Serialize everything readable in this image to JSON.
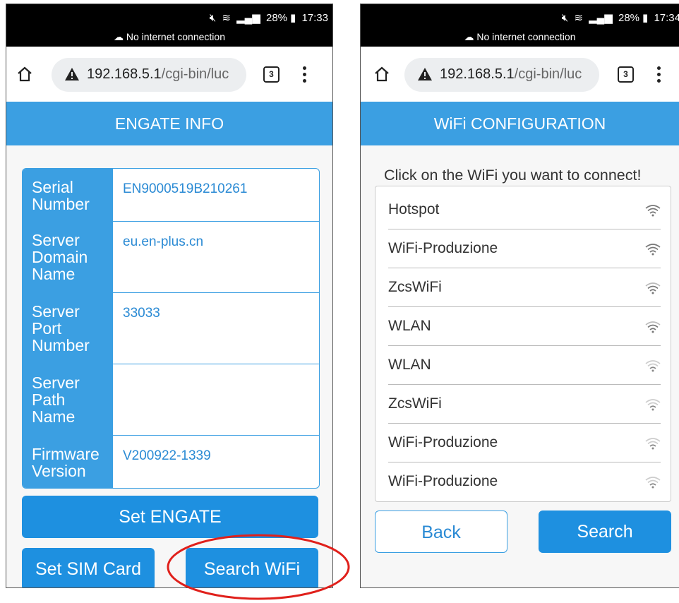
{
  "status_bar": {
    "left_screen": {
      "battery": "28%",
      "time": "17:33"
    },
    "right_screen": {
      "battery": "28%",
      "time": "17:34"
    },
    "no_internet": "No internet connection"
  },
  "browser": {
    "url_host": "192.168.5.1",
    "url_path": "/cgi-bin/luc",
    "tab_count": "3"
  },
  "engate_info": {
    "title": "ENGATE INFO",
    "rows": [
      {
        "label": "Serial Number",
        "value": "EN9000519B210261"
      },
      {
        "label": "Server Domain Name",
        "value": "eu.en-plus.cn"
      },
      {
        "label": "Server Port Number",
        "value": "33033"
      },
      {
        "label": "Server Path Name",
        "value": ""
      },
      {
        "label": "Firmware Version",
        "value": "V200922-1339"
      }
    ],
    "buttons": {
      "set_engate": "Set ENGATE",
      "set_sim_card": "Set SIM Card",
      "search_wifi": "Search WiFi"
    }
  },
  "wifi_config": {
    "title": "WiFi CONFIGURATION",
    "prompt": "Click on the WiFi you want to connect!",
    "networks": [
      {
        "name": "Hotspot",
        "signal": "strong"
      },
      {
        "name": "WiFi-Produzione",
        "signal": "strong"
      },
      {
        "name": "ZcsWiFi",
        "signal": "medium"
      },
      {
        "name": "WLAN",
        "signal": "medium"
      },
      {
        "name": "WLAN",
        "signal": "weak"
      },
      {
        "name": "ZcsWiFi",
        "signal": "weak"
      },
      {
        "name": "WiFi-Produzione",
        "signal": "weak"
      },
      {
        "name": "WiFi-Produzione",
        "signal": "weak"
      }
    ],
    "buttons": {
      "back": "Back",
      "search": "Search"
    }
  },
  "colors": {
    "accent": "#3b9fe2",
    "button": "#1e90e0",
    "value_text": "#2a8ad4",
    "highlight": "#e0201b"
  },
  "icons": {
    "home": "home-icon",
    "warning": "warning-icon",
    "tabs": "tabs-icon",
    "menu": "more-vert-icon",
    "wifi": "wifi-signal-icon",
    "no_internet": "cloud-off-icon"
  }
}
